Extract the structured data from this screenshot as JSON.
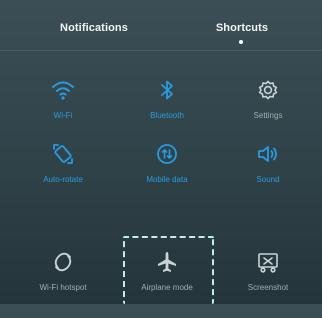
{
  "tabs": [
    {
      "label": "Notifications"
    },
    {
      "label": "Shortcuts",
      "active": true
    }
  ],
  "colors": {
    "accent_on": "#2a9be0",
    "icon_off": "#c9d3d6",
    "highlight": "#bfeeea"
  },
  "shortcuts": [
    {
      "label": "Wi-Fi",
      "icon": "wifi-icon",
      "state": "on"
    },
    {
      "label": "Bluetooth",
      "icon": "bluetooth-icon",
      "state": "on"
    },
    {
      "label": "Settings",
      "icon": "gear-icon",
      "state": "off"
    },
    {
      "label": "Auto-rotate",
      "icon": "auto-rotate-icon",
      "state": "on"
    },
    {
      "label": "Mobile data",
      "icon": "mobile-data-icon",
      "state": "on"
    },
    {
      "label": "Sound",
      "icon": "speaker-icon",
      "state": "on"
    },
    {
      "label": "Wi-Fi hotspot",
      "icon": "hotspot-icon",
      "state": "off"
    },
    {
      "label": "Airplane mode",
      "icon": "airplane-icon",
      "state": "off",
      "highlighted": true
    },
    {
      "label": "Screenshot",
      "icon": "screenshot-icon",
      "state": "off"
    }
  ]
}
